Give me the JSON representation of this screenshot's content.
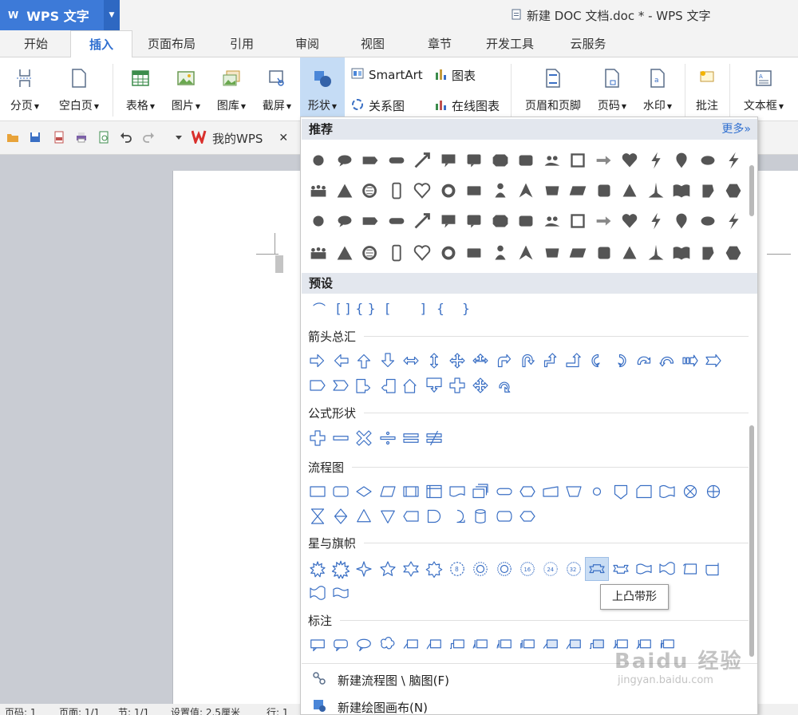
{
  "app": {
    "logo": "WPS 文字",
    "doc_title": "新建 DOC 文档.doc * - WPS 文字"
  },
  "tabs": [
    "开始",
    "插入",
    "页面布局",
    "引用",
    "审阅",
    "视图",
    "章节",
    "开发工具",
    "云服务"
  ],
  "active_tab": "插入",
  "ribbon": {
    "page_break": "分页",
    "blank_page": "空白页",
    "table": "表格",
    "picture": "图片",
    "gallery": "图库",
    "screenshot": "截屏",
    "shapes": "形状",
    "smartart": "SmartArt",
    "chart": "图表",
    "relation": "关系图",
    "online_chart": "在线图表",
    "header_footer": "页眉和页脚",
    "page_number": "页码",
    "watermark": "水印",
    "comment": "批注",
    "textbox": "文本框"
  },
  "quick_access": {
    "mywps": "我的WPS"
  },
  "gallery": {
    "recommended": "推荐",
    "more": "更多»",
    "presets": "预设",
    "cat_arrows": "箭头总汇",
    "cat_formula": "公式形状",
    "cat_flowchart": "流程图",
    "cat_stars": "星与旗帜",
    "cat_callouts": "标注",
    "action_flowchart": "新建流程图 \\ 脑图(F)",
    "action_canvas": "新建绘图画布(N)",
    "tooltip": "上凸带形"
  },
  "status": {
    "page": "页码: 1",
    "pages": "页面: 1/1",
    "section": "节: 1/1",
    "setting": "设置值: 2.5厘米",
    "row": "行: 1"
  },
  "watermark": {
    "logo": "Baidu 经验",
    "url": "jingyan.baidu.com"
  },
  "colors": {
    "accent": "#2f6fd0",
    "logo_bg": "#3d7ad8",
    "shape_blue": "#3a6fc4",
    "shape_gray": "#555555"
  }
}
